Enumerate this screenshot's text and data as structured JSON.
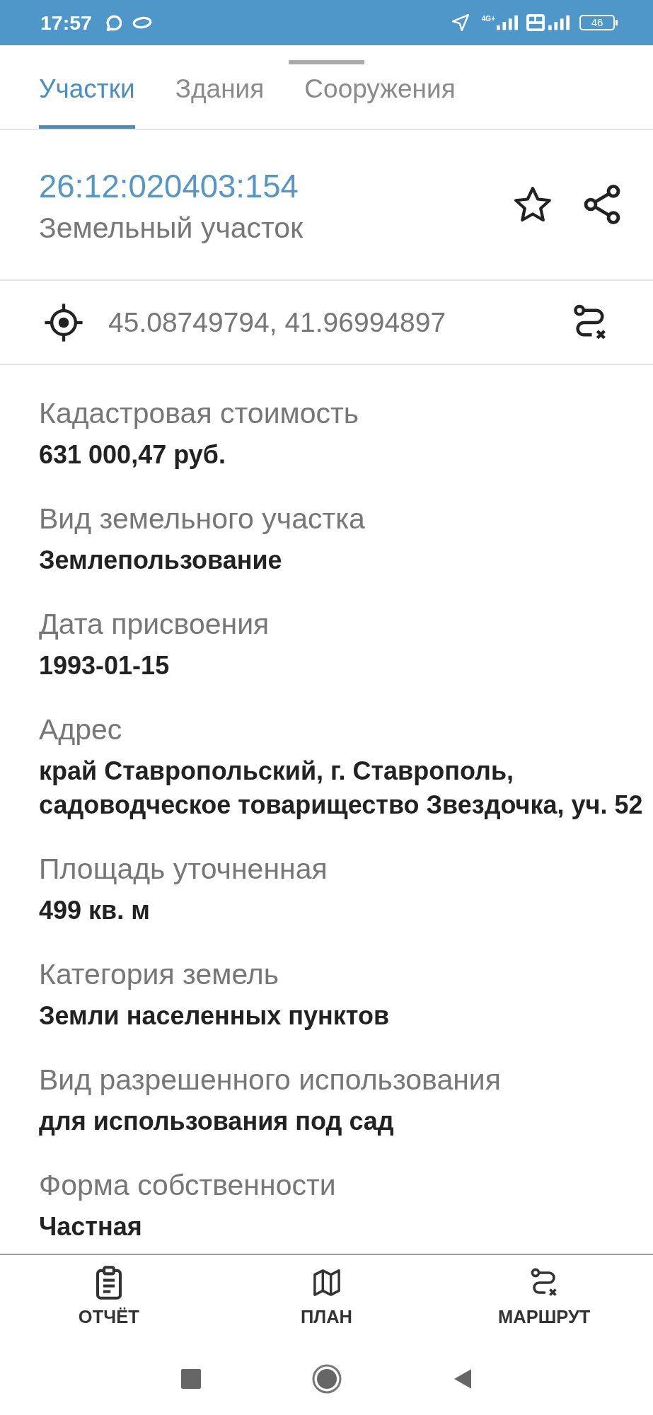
{
  "status_bar": {
    "time": "17:57",
    "network_type": "4G+",
    "battery": "46"
  },
  "sheet": {
    "tabs": [
      {
        "label": "Участки",
        "selected": true
      },
      {
        "label": "Здания",
        "selected": false
      },
      {
        "label": "Сооружения",
        "selected": false
      }
    ],
    "parcel": {
      "number": "26:12:020403:154",
      "type": "Земельный участок",
      "favorite": false
    },
    "coordinates": "45.08749794, 41.96994897",
    "fields": [
      {
        "label": "Кадастровая стоимость",
        "value": "631 000,47 руб."
      },
      {
        "label": "Вид земельного участка",
        "value": "Землепользование"
      },
      {
        "label": "Дата присвоения",
        "value": "1993-01-15"
      },
      {
        "label": "Адрес",
        "value": "край Ставропольский, г. Ставрополь,\nсадоводческое товарищество Звездочка, уч. 52"
      },
      {
        "label": "Площадь уточненная",
        "value": "499 кв. м"
      },
      {
        "label": "Категория земель",
        "value": "Земли населенных пунктов"
      },
      {
        "label": "Вид разрешенного использования",
        "value": "для использования под сад"
      },
      {
        "label": "Форма собственности",
        "value": "Частная"
      }
    ]
  },
  "bottom_nav": [
    {
      "kind": "report",
      "label": "ОТЧЁТ"
    },
    {
      "kind": "plan",
      "label": "ПЛАН"
    },
    {
      "kind": "route",
      "label": "МАРШРУТ"
    }
  ]
}
